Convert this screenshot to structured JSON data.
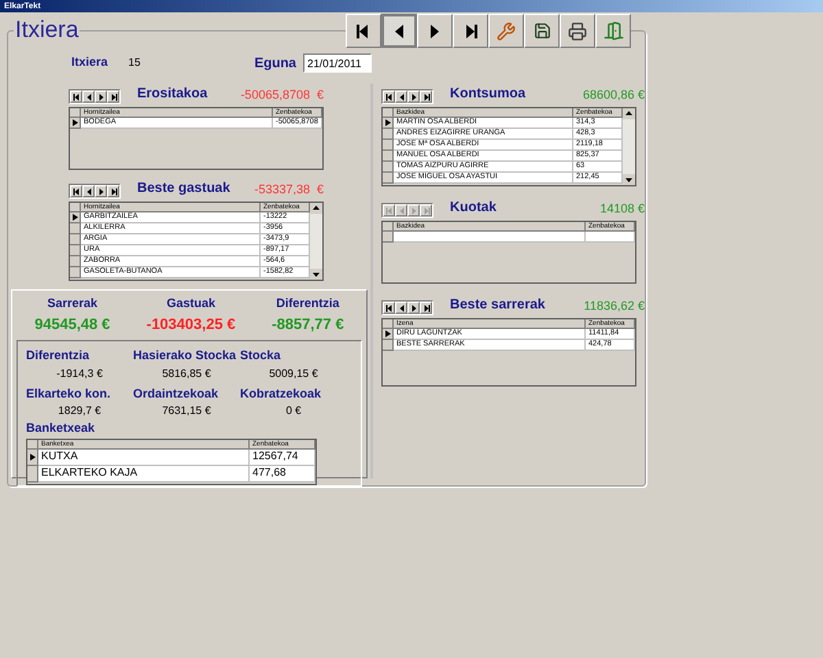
{
  "window": {
    "title": "ElkarTekt"
  },
  "form": {
    "legend": "Itxiera"
  },
  "toolbar": [
    {
      "kind": "first",
      "selected": false
    },
    {
      "kind": "prev",
      "selected": true
    },
    {
      "kind": "next",
      "selected": false
    },
    {
      "kind": "last",
      "selected": false
    },
    {
      "kind": "tools",
      "selected": false
    },
    {
      "kind": "save",
      "selected": false
    },
    {
      "kind": "print",
      "selected": false
    },
    {
      "kind": "exit",
      "selected": false
    }
  ],
  "header": {
    "itxiera_label": "Itxiera",
    "itxiera_value": "15",
    "eguna_label": "Eguna",
    "eguna_value": "21/01/2011"
  },
  "left_grids": [
    {
      "title": "Erositakoa",
      "total": "-50065,8708  €",
      "color": "#ff3333",
      "nav_disabled": false,
      "scrollable": false,
      "columns": [
        "Hornitzailea",
        "Zenbatekoa"
      ],
      "rows": [
        {
          "cells": [
            "BODEGA",
            "-50065,8708"
          ],
          "selected": true
        }
      ]
    },
    {
      "title": "Beste gastuak",
      "total": "-53337,38  €",
      "color": "#ff3333",
      "nav_disabled": false,
      "scrollable": true,
      "columns": [
        "Hornitzailea",
        "Zenbatekoa"
      ],
      "rows": [
        {
          "cells": [
            "GARBITZAILEA",
            "-13222"
          ],
          "selected": true
        },
        {
          "cells": [
            "ALKILERRA",
            "-3956"
          ],
          "selected": false
        },
        {
          "cells": [
            "ARGIA",
            "-3473,9"
          ],
          "selected": false
        },
        {
          "cells": [
            "URA",
            "-897,17"
          ],
          "selected": false
        },
        {
          "cells": [
            "ZABORRA",
            "-564,6"
          ],
          "selected": false
        },
        {
          "cells": [
            "GASOLETA-BUTANOA",
            "-1582,82"
          ],
          "selected": false
        }
      ]
    }
  ],
  "right_grids": [
    {
      "title": "Kontsumoa",
      "total": "68600,86 €",
      "color": "#229922",
      "nav_disabled": false,
      "scrollable": true,
      "columns": [
        "Bazkidea",
        "Zenbatekoa"
      ],
      "rows": [
        {
          "cells": [
            "MARTIN OSA ALBERDI",
            "314,3"
          ],
          "selected": true
        },
        {
          "cells": [
            "ANDRES EIZAGIRRE URANGA",
            "428,3"
          ],
          "selected": false
        },
        {
          "cells": [
            "JOSE Mª OSA ALBERDI",
            "2119,18"
          ],
          "selected": false
        },
        {
          "cells": [
            "MANUEL OSA ALBERDI",
            "825,37"
          ],
          "selected": false
        },
        {
          "cells": [
            "TOMAS AIZPURU AGIRRE",
            "63"
          ],
          "selected": false
        },
        {
          "cells": [
            "JOSE MIGUEL OSA AYASTUI",
            "212,45"
          ],
          "selected": false
        }
      ]
    },
    {
      "title": "Kuotak",
      "total": "14108 €",
      "color": "#229922",
      "nav_disabled": true,
      "scrollable": false,
      "columns": [
        "Bazkidea",
        "Zenbatekoa"
      ]
    },
    {
      "title": "Beste sarrerak",
      "total": "11836,62 €",
      "color": "#229922",
      "nav_disabled": false,
      "scrollable": false,
      "columns": [
        "Izena",
        "Zenbatekoa"
      ],
      "rows": [
        {
          "cells": [
            "DIRU LAGUNTZAK",
            "11411,84"
          ],
          "selected": true
        },
        {
          "cells": [
            "BESTE SARRERAK",
            "424,78"
          ],
          "selected": false
        }
      ]
    }
  ],
  "totals": [
    {
      "label": "Sarrerak",
      "value": "94545,48 €",
      "color": "#229922"
    },
    {
      "label": "Gastuak",
      "value": "-103403,25 €",
      "color": "#ff2222"
    },
    {
      "label": "Diferentzia",
      "value": "-8857,77 €",
      "color": "#229922"
    }
  ],
  "details": [
    {
      "label": "Diferentzia",
      "value": "-1914,3 €"
    },
    {
      "label": "Hasierako Stocka",
      "value": "5816,85 €"
    },
    {
      "label": "Stocka",
      "value": "5009,15 €"
    },
    {
      "label": "Elkarteko kon.",
      "value": "1829,7 €"
    },
    {
      "label": "Ordaintzekoak",
      "value": "7631,15 €"
    },
    {
      "label": "Kobratzekoak",
      "value": "0 €"
    }
  ],
  "banks": {
    "title": "Banketxeak",
    "columns": [
      "Banketxea",
      "Zenbatekoa"
    ],
    "rows": [
      {
        "cells": [
          "KUTXA",
          "12567,74"
        ],
        "selected": true
      },
      {
        "cells": [
          "ELKARTEKO KAJA",
          "477,68"
        ],
        "selected": false
      }
    ]
  }
}
